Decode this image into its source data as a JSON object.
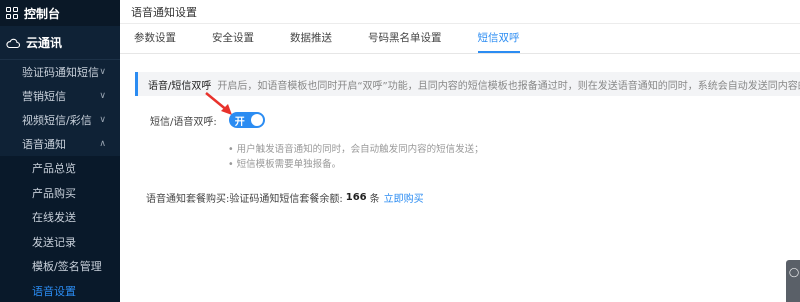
{
  "sidebar": {
    "console_label": "控制台",
    "section_label": "云通讯",
    "items": [
      {
        "label": "验证码通知短信",
        "chevron": "∨"
      },
      {
        "label": "营销短信",
        "chevron": "∨"
      },
      {
        "label": "视频短信/彩信",
        "chevron": "∨"
      },
      {
        "label": "语音通知",
        "chevron": "∧"
      }
    ],
    "sub_items": [
      {
        "label": "产品总览"
      },
      {
        "label": "产品购买"
      },
      {
        "label": "在线发送"
      },
      {
        "label": "发送记录"
      },
      {
        "label": "模板/签名管理"
      },
      {
        "label": "语音设置"
      }
    ]
  },
  "main": {
    "page_title": "语音通知设置",
    "tabs": [
      {
        "label": "参数设置"
      },
      {
        "label": "安全设置"
      },
      {
        "label": "数据推送"
      },
      {
        "label": "号码黑名单设置"
      },
      {
        "label": "短信双呼"
      }
    ],
    "notice": {
      "title": "语音/短信双呼",
      "text": "开启后，如语音模板也同时开启“双呼”功能，且同内容的短信模板也报备通过时，则在发送语音通知的同时，系统会自动发送同内容的短信"
    },
    "toggle": {
      "label": "短信/语音双呼:",
      "value": "开"
    },
    "tips": [
      "用户触发语音通知的同时，会自动触发同内容的短信发送；",
      "短信模板需要单独报备。"
    ],
    "package": {
      "label": "语音通知套餐购买:",
      "balance_label": "验证码通知短信套餐余额:",
      "balance_value": "166",
      "unit": "条",
      "buy_link": "立即购买"
    }
  },
  "colors": {
    "accent": "#2b8cf2",
    "sidebar_bg": "#0f2236",
    "arrow": "#e8322c"
  }
}
